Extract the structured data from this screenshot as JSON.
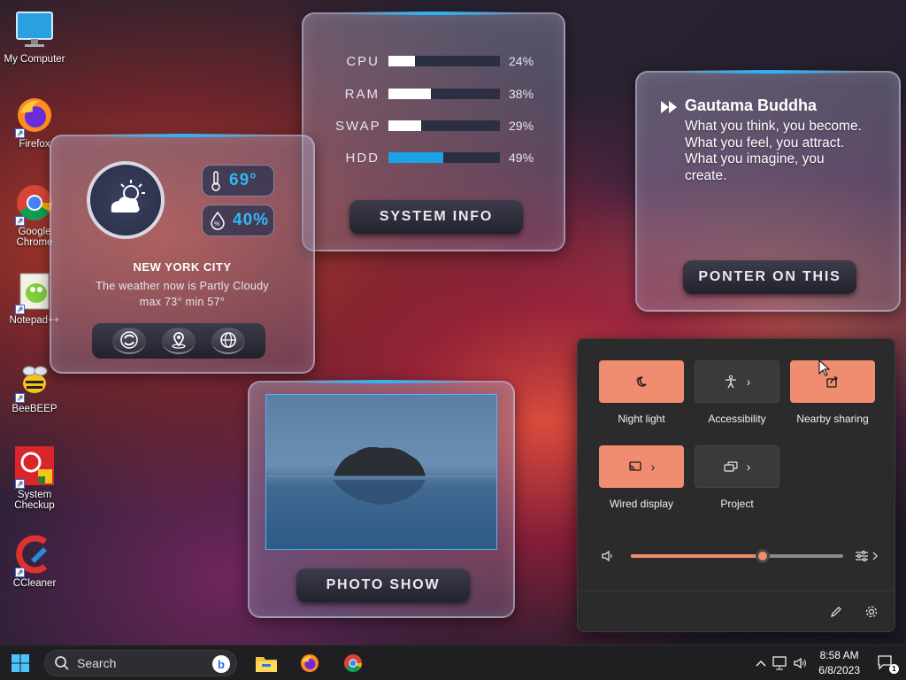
{
  "desktop": {
    "icons": [
      {
        "label": "My Computer"
      },
      {
        "label": "Firefox"
      },
      {
        "label": "Google Chrome"
      },
      {
        "label": "Notepad++"
      },
      {
        "label": "BeeBEEP"
      },
      {
        "label": "System Checkup"
      },
      {
        "label": "CCleaner"
      }
    ]
  },
  "weather": {
    "temperature": "69°",
    "humidity": "40%",
    "city": "NEW YORK CITY",
    "condition_prefix": "The weather now is ",
    "condition": "Partly Cloudy",
    "range": "max 73° min 57°"
  },
  "sysinfo": {
    "rows": [
      {
        "label": "CPU",
        "percent": "24%",
        "value": 0.24,
        "color": "#ffffff"
      },
      {
        "label": "RAM",
        "percent": "38%",
        "value": 0.38,
        "color": "#ffffff"
      },
      {
        "label": "SWAP",
        "percent": "29%",
        "value": 0.29,
        "color": "#ffffff"
      },
      {
        "label": "HDD",
        "percent": "49%",
        "value": 0.49,
        "color": "#1aa3e8"
      }
    ],
    "button": "SYSTEM INFO"
  },
  "quote": {
    "author": "Gautama Buddha",
    "text": "What you think, you become. What you feel, you attract. What you imagine, you create.",
    "button": "PONTER ON THIS"
  },
  "photo": {
    "button": "PHOTO SHOW"
  },
  "quick_settings": {
    "tiles": [
      {
        "label": "Night light",
        "icon": "night-light-icon",
        "on": true
      },
      {
        "label": "Accessibility",
        "icon": "accessibility-icon",
        "on": false
      },
      {
        "label": "Nearby sharing",
        "icon": "share-icon",
        "on": true
      },
      {
        "label": "Wired display",
        "icon": "cast-icon",
        "on": true
      },
      {
        "label": "Project",
        "icon": "project-icon",
        "on": false
      }
    ],
    "volume": 0.62,
    "accent": "#f08c70"
  },
  "taskbar": {
    "search_placeholder": "Search",
    "time": "8:58 AM",
    "date": "6/8/2023",
    "notifications": "1"
  }
}
